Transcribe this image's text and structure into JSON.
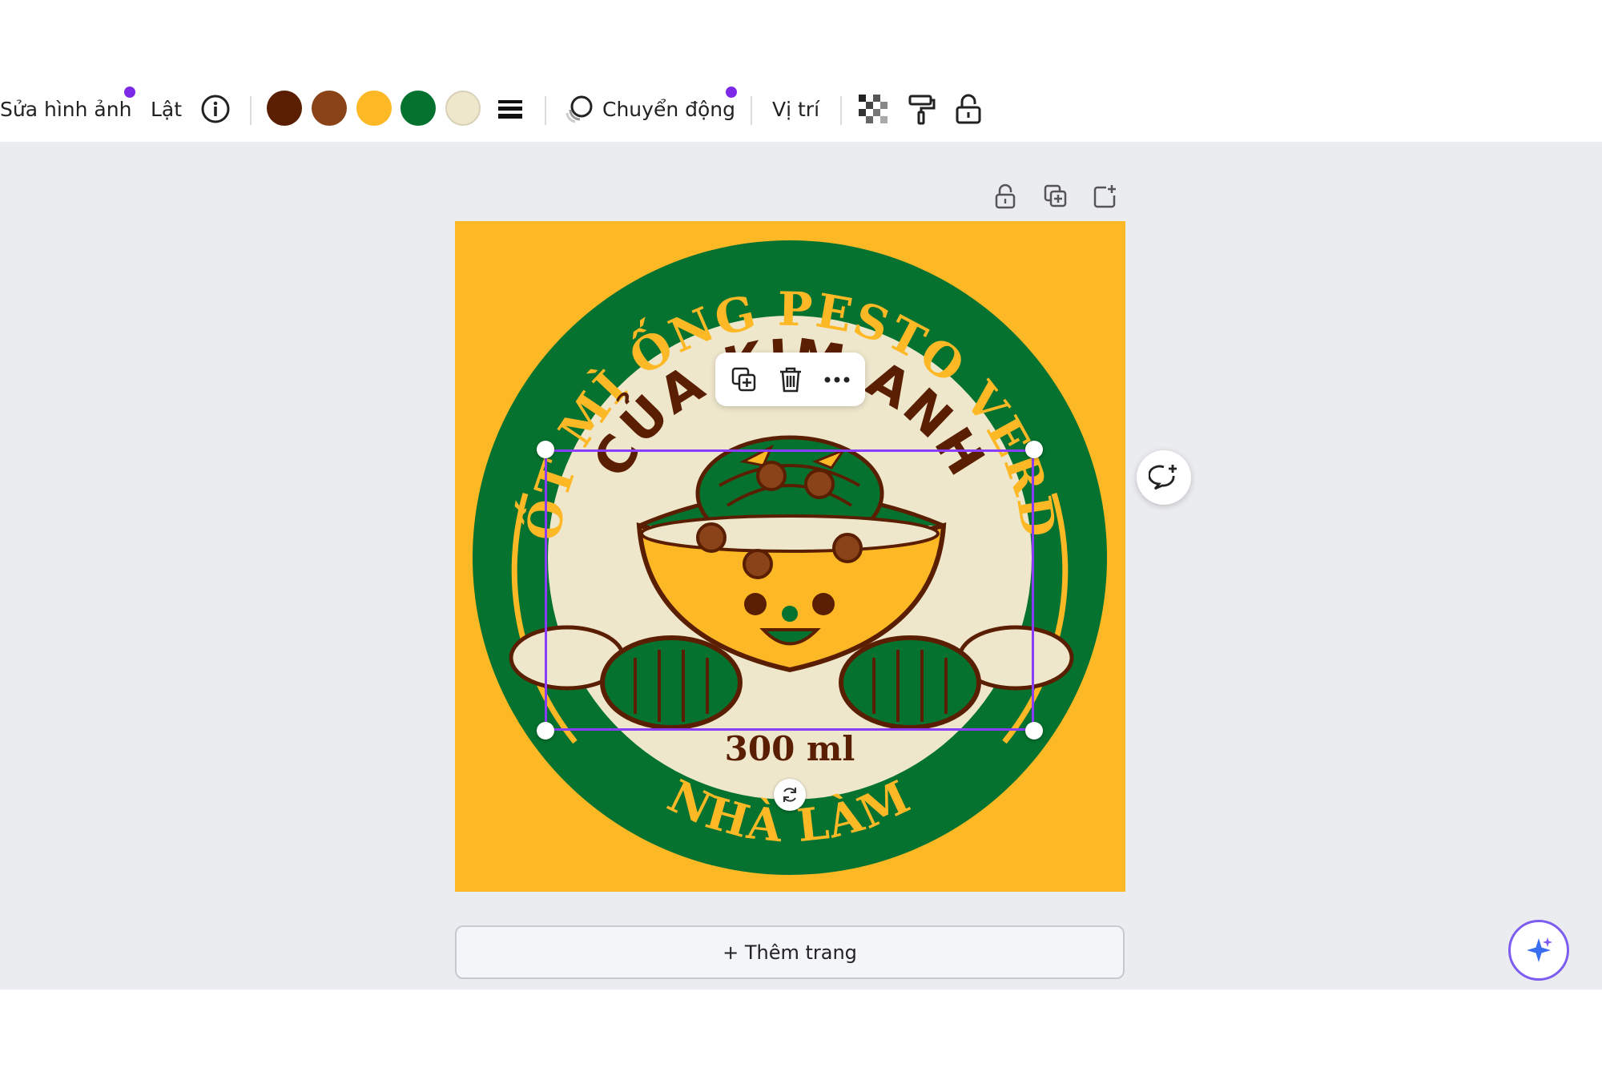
{
  "toolbar": {
    "edit_image": "Sửa hình ảnh",
    "flip": "Lật",
    "animate": "Chuyển động",
    "position": "Vị trí",
    "colors": [
      "#5a1f02",
      "#8a4318",
      "#fdb825",
      "#05722f",
      "#efe7cc"
    ]
  },
  "design": {
    "top_text": "SỐT MÌ ỐNG PESTO VERDE",
    "middle_text": "CỦA KIM ANH",
    "volume": "300 ml",
    "bottom_text": "NHÀ LÀM"
  },
  "add_page": "+ Thêm trang"
}
